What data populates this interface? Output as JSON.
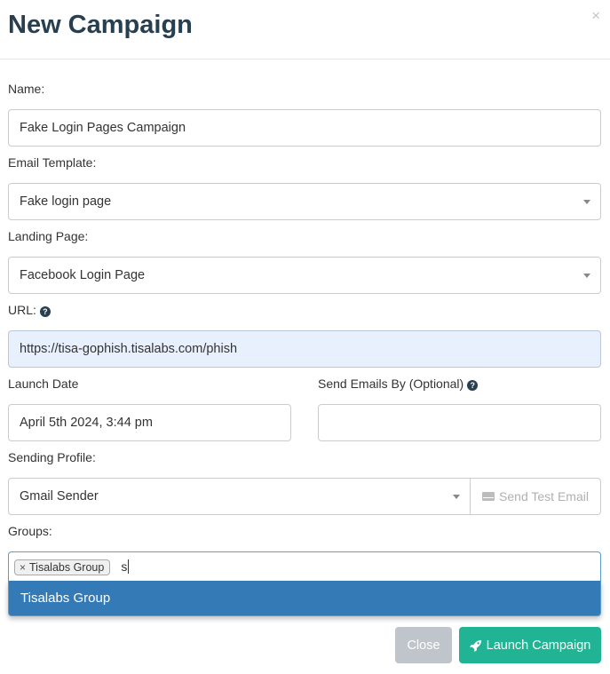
{
  "modal": {
    "title": "New Campaign",
    "close_glyph": "×"
  },
  "form": {
    "name": {
      "label": "Name:",
      "value": "Fake Login Pages Campaign"
    },
    "email_template": {
      "label": "Email Template:",
      "value": "Fake login page"
    },
    "landing_page": {
      "label": "Landing Page:",
      "value": "Facebook Login Page"
    },
    "url": {
      "label": "URL:",
      "value": "https://tisa-gophish.tisalabs.com/phish"
    },
    "launch_date": {
      "label": "Launch Date",
      "value": "April 5th 2024, 3:44 pm"
    },
    "send_by": {
      "label": "Send Emails By (Optional)",
      "value": ""
    },
    "sending_profile": {
      "label": "Sending Profile:",
      "value": "Gmail Sender",
      "test_button": "Send Test Email"
    },
    "groups": {
      "label": "Groups:",
      "selected_tags": [
        "Tisalabs Group"
      ],
      "tag_remove_glyph": "×",
      "typed_text": "s",
      "dropdown_options": [
        "Tisalabs Group"
      ]
    }
  },
  "footer": {
    "close_label": "Close",
    "launch_label": "Launch Campaign"
  },
  "icons": {
    "help": "question-circle-icon",
    "envelope": "envelope-icon",
    "rocket": "rocket-icon",
    "caret": "caret-down-icon"
  },
  "colors": {
    "title": "#283f50",
    "launch_button": "#21b494",
    "close_button": "#bfc5cb",
    "dropdown_highlight": "#337ab7",
    "url_field_bg": "#e8f0fe"
  }
}
